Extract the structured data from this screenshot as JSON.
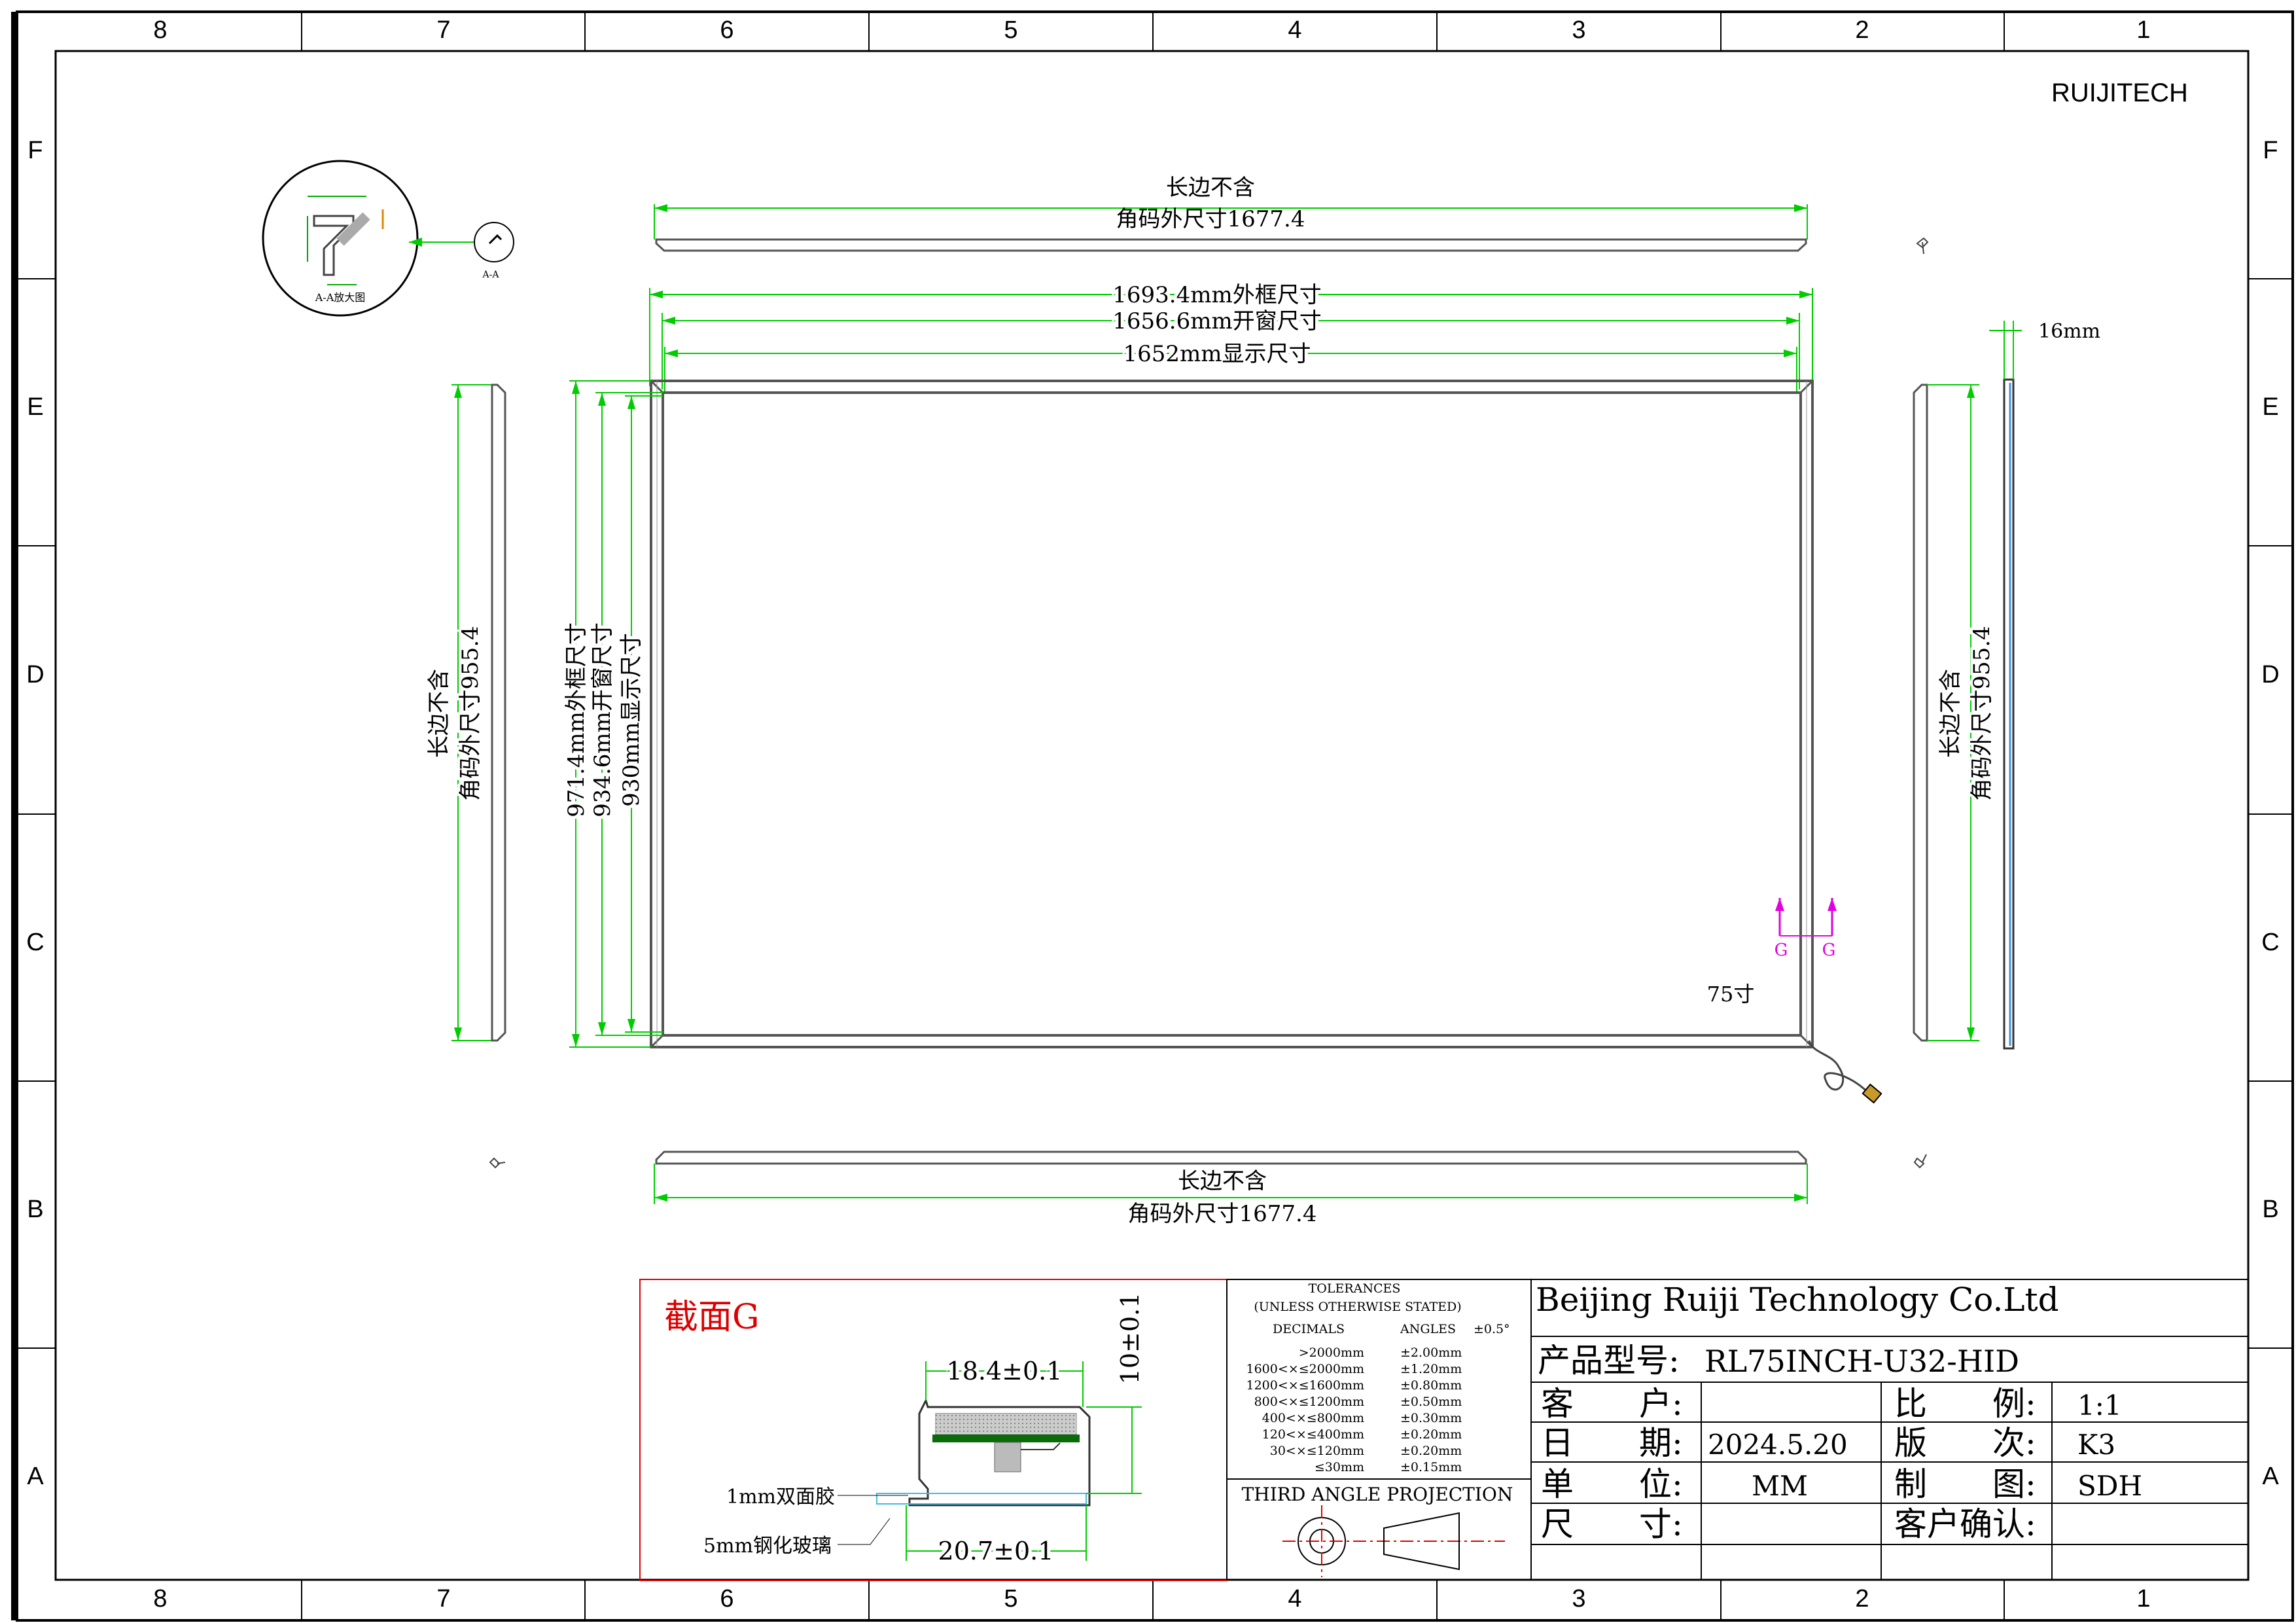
{
  "company_mark": "RUIJITECH",
  "grid": {
    "cols": [
      "8",
      "7",
      "6",
      "5",
      "4",
      "3",
      "2",
      "1"
    ],
    "rows": [
      "F",
      "E",
      "D",
      "C",
      "B",
      "A"
    ]
  },
  "top_bar": {
    "line1": "长边不含",
    "line2": "角码外尺寸1677.4"
  },
  "bottom_bar": {
    "line1": "长边不含",
    "line2": "角码外尺寸1677.4"
  },
  "left_bar": {
    "line1": "长边不含",
    "line2": "角码外尺寸955.4"
  },
  "right_bar": {
    "line1": "长边不含",
    "line2": "角码外尺寸955.4"
  },
  "dims_h": [
    "1693.4mm外框尺寸",
    "1656.6mm开窗尺寸",
    "1652mm显示尺寸"
  ],
  "dims_v": [
    "971.4mm外框尺寸",
    "934.6mm开窗尺寸",
    "930mm显示尺寸"
  ],
  "side_width": "16mm",
  "size_label": "75寸",
  "section_markers": [
    "G",
    "G"
  ],
  "detail": {
    "label": "A-A放大图",
    "section": "A-A"
  },
  "section_view": {
    "title": "截面G",
    "dim_width_top": "18.4±0.1",
    "dim_width_bottom": "20.7±0.1",
    "dim_height": "10±0.1",
    "callout_tape": "1mm双面胶",
    "callout_glass": "5mm钢化玻璃"
  },
  "tolerances": {
    "title": "TOLERANCES",
    "subtitle": "(UNLESS OTHERWISE STATED)",
    "col_decimals": "DECIMALS",
    "col_angles": "ANGLES",
    "angle_tol": "±0.5°",
    "rows": [
      {
        "range": ">2000mm",
        "tol": "±2.00mm"
      },
      {
        "range": "1600<×≤2000mm",
        "tol": "±1.20mm"
      },
      {
        "range": "1200<×≤1600mm",
        "tol": "±0.80mm"
      },
      {
        "range": "800<×≤1200mm",
        "tol": "±0.50mm"
      },
      {
        "range": "400<×≤800mm",
        "tol": "±0.30mm"
      },
      {
        "range": "120<×≤400mm",
        "tol": "±0.20mm"
      },
      {
        "range": "30<×≤120mm",
        "tol": "±0.20mm"
      },
      {
        "range": "≤30mm",
        "tol": "±0.15mm"
      }
    ],
    "projection": "THIRD ANGLE PROJECTION"
  },
  "title_block": {
    "company": "Beijing Ruiji Technology Co.Ltd",
    "product_label": "产品型号:",
    "product_value": "RL75INCH-U32-HID",
    "customer_label": "客　　户:",
    "customer_value": "",
    "date_label": "日　　期:",
    "date_value": "2024.5.20",
    "unit_label": "单　　位:",
    "unit_value": "MM",
    "size_label": "尺　　寸:",
    "size_value": "",
    "scale_label": "比　　例:",
    "scale_value": "1:1",
    "version_label": "版　　次:",
    "version_value": "K3",
    "drawn_label": "制　　图:",
    "drawn_value": "SDH",
    "confirm_label": "客户确认:",
    "confirm_value": ""
  }
}
